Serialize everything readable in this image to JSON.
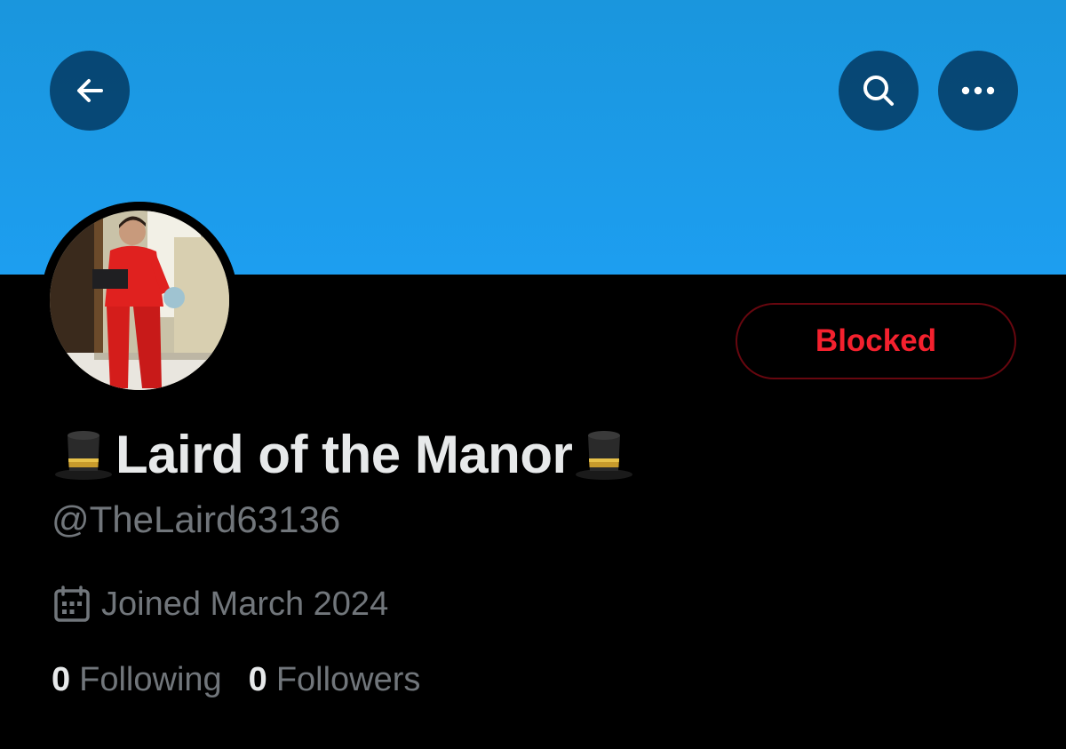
{
  "header": {
    "banner_color": "#1d9bf0",
    "back_icon": "arrow-left-icon",
    "search_icon": "search-icon",
    "more_icon": "more-horizontal-icon"
  },
  "profile": {
    "display_name": "Laird of the Manor",
    "name_emoji": "top-hat-icon",
    "handle": "@TheLaird63136",
    "joined": "Joined March 2024",
    "joined_icon": "calendar-icon",
    "relationship_button": "Blocked",
    "relationship_color": "#f4212e"
  },
  "stats": {
    "following_count": "0",
    "following_label": "Following",
    "followers_count": "0",
    "followers_label": "Followers"
  }
}
